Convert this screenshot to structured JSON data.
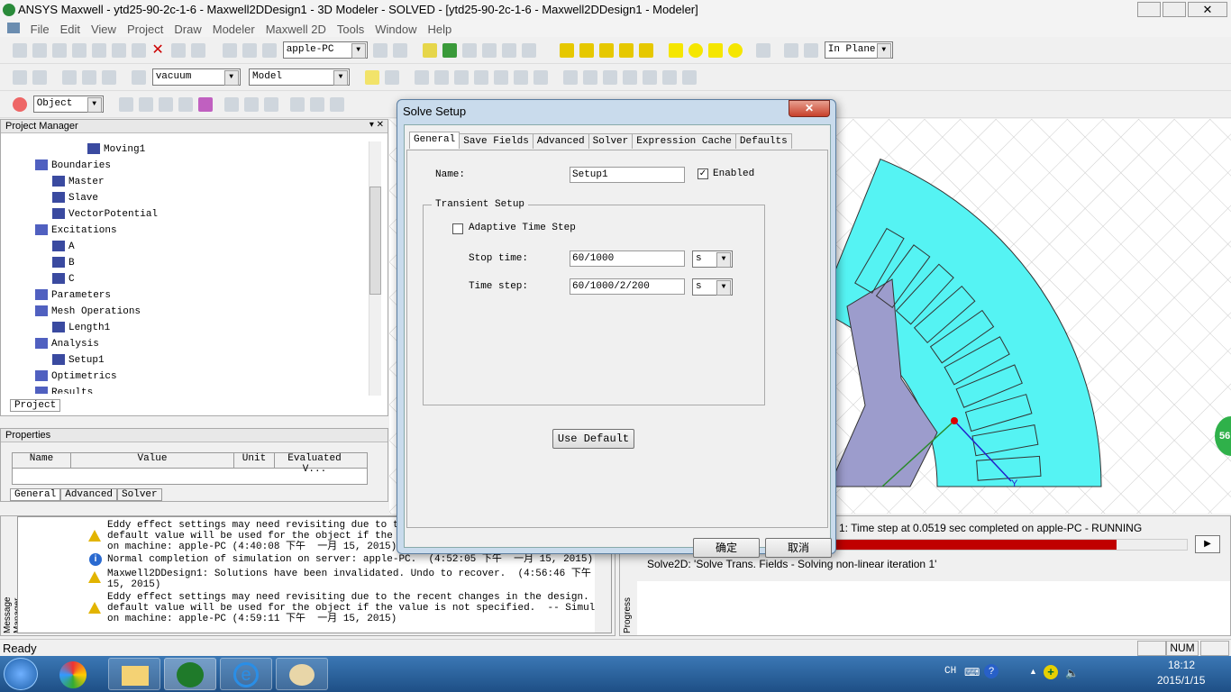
{
  "window": {
    "title": "ANSYS Maxwell - ytd25-90-2c-1-6 - Maxwell2DDesign1 - 3D Modeler - SOLVED - [ytd25-90-2c-1-6 - Maxwell2DDesign1 - Modeler]"
  },
  "menu": [
    "File",
    "Edit",
    "View",
    "Project",
    "Draw",
    "Modeler",
    "Maxwell 2D",
    "Tools",
    "Window",
    "Help"
  ],
  "toolbar": {
    "machine": "apple-PC",
    "material": "vacuum",
    "model": "Model",
    "select_mode": "Object",
    "plane": "In Plane"
  },
  "project_manager": {
    "title": "Project Manager",
    "tab": "Project",
    "items": [
      {
        "label": "Moving1",
        "level": 4
      },
      {
        "label": "Boundaries",
        "level": 2
      },
      {
        "label": "Master",
        "level": 3
      },
      {
        "label": "Slave",
        "level": 3
      },
      {
        "label": "VectorPotential",
        "level": 3
      },
      {
        "label": "Excitations",
        "level": 2
      },
      {
        "label": "A",
        "level": 3
      },
      {
        "label": "B",
        "level": 3
      },
      {
        "label": "C",
        "level": 3
      },
      {
        "label": "Parameters",
        "level": 2
      },
      {
        "label": "Mesh Operations",
        "level": 2
      },
      {
        "label": "Length1",
        "level": 3
      },
      {
        "label": "Analysis",
        "level": 2
      },
      {
        "label": "Setup1",
        "level": 3
      },
      {
        "label": "Optimetrics",
        "level": 2
      },
      {
        "label": "Results",
        "level": 2
      }
    ]
  },
  "properties": {
    "title": "Properties",
    "columns": [
      "Name",
      "Value",
      "Unit",
      "Evaluated V..."
    ],
    "tabs": [
      "General",
      "Advanced",
      "Solver"
    ]
  },
  "messages": {
    "title": "Message Manager",
    "items": [
      {
        "type": "warning",
        "text": "Eddy effect settings may need revisiting due to the recent changes in the design.  The\ndefault value will be used for the object if the value is not specified.  -- Simulating\non machine: apple-PC (4:40:08 下午  一月 15, 2015)"
      },
      {
        "type": "info",
        "text": "Normal completion of simulation on server: apple-PC.  (4:52:05 下午  一月 15, 2015)"
      },
      {
        "type": "warning",
        "text": "Maxwell2DDesign1: Solutions have been invalidated. Undo to recover.  (4:56:46 下午  一月\n15, 2015)"
      },
      {
        "type": "warning",
        "text": "Eddy effect settings may need revisiting due to the recent changes in the design.  The\ndefault value will be used for the object if the value is not specified.  -- Simulating\non machine: apple-PC (4:59:11 下午  一月 15, 2015)"
      }
    ]
  },
  "progress": {
    "title": "Progress",
    "status": "1: Time step at 0.0519 sec completed on apple-PC - RUNNING",
    "percent": 80,
    "detail": "Solve2D: 'Solve Trans. Fields - Solving non-linear iteration 1'",
    "color": "#c00000"
  },
  "status_bar": {
    "text": "Ready",
    "num": "NUM"
  },
  "dialog": {
    "title": "Solve Setup",
    "tabs": [
      "General",
      "Save Fields",
      "Advanced",
      "Solver",
      "Expression Cache",
      "Defaults"
    ],
    "name_label": "Name:",
    "name_value": "Setup1",
    "enabled_label": "Enabled",
    "enabled": true,
    "group": "Transient Setup",
    "adaptive_label": "Adaptive Time Step",
    "adaptive": false,
    "stop_time_label": "Stop time:",
    "stop_time": "60/1000",
    "stop_unit": "s",
    "time_step_label": "Time step:",
    "time_step": "60/1000/2/200",
    "step_unit": "s",
    "use_default": "Use Default",
    "ok": "确定",
    "cancel": "取消"
  },
  "viewport": {
    "axis_label": "Y",
    "badge": "56",
    "motor_color": "#55f3f3",
    "rotor_color": "#9c9ccc"
  },
  "taskbar": {
    "lang": "CH",
    "time": "18:12",
    "date": "2015/1/15"
  }
}
